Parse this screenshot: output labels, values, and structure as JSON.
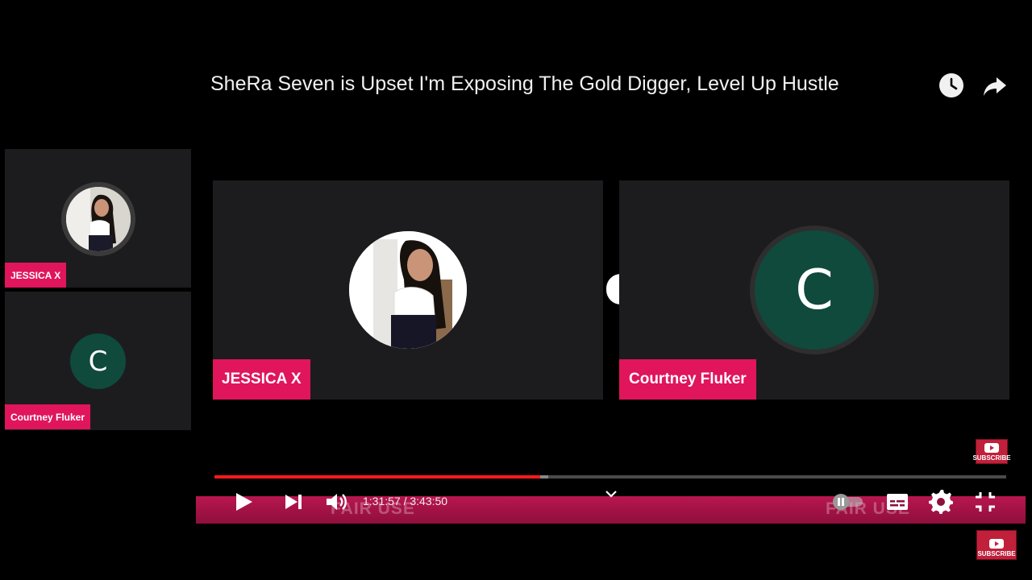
{
  "video": {
    "title": "SheRa Seven is Upset I'm Exposing The Gold Digger, Level Up Hustle",
    "current_time": "1:31:57",
    "duration": "3:43:50",
    "time_display": "1:31:57 / 3:43:50",
    "progress_fraction": 0.411
  },
  "participants": [
    {
      "name": "JESSICA X",
      "avatar_type": "photo"
    },
    {
      "name": "Courtney Fluker",
      "avatar_type": "letter",
      "initial": "C",
      "avatar_color": "#0f4a3d"
    }
  ],
  "watermark": {
    "left": "FAIR USE",
    "right": "FAIR USE"
  },
  "subscribe_badge": {
    "label": "SUBSCRIBE"
  },
  "colors": {
    "name_tag": "#e0155b",
    "progress": "#ff1a1a",
    "control_bar": "#b8164f",
    "tile_bg": "#1c1c1f"
  },
  "icons": {
    "watch_later": "clock-icon",
    "share": "share-arrow-icon",
    "play": "play-icon",
    "next": "skip-next-icon",
    "volume": "volume-icon",
    "chevron": "chevron-down-icon",
    "autoplay": "autoplay-toggle-icon",
    "captions": "captions-icon",
    "settings": "gear-icon",
    "exit_fullscreen": "exit-fullscreen-icon"
  }
}
